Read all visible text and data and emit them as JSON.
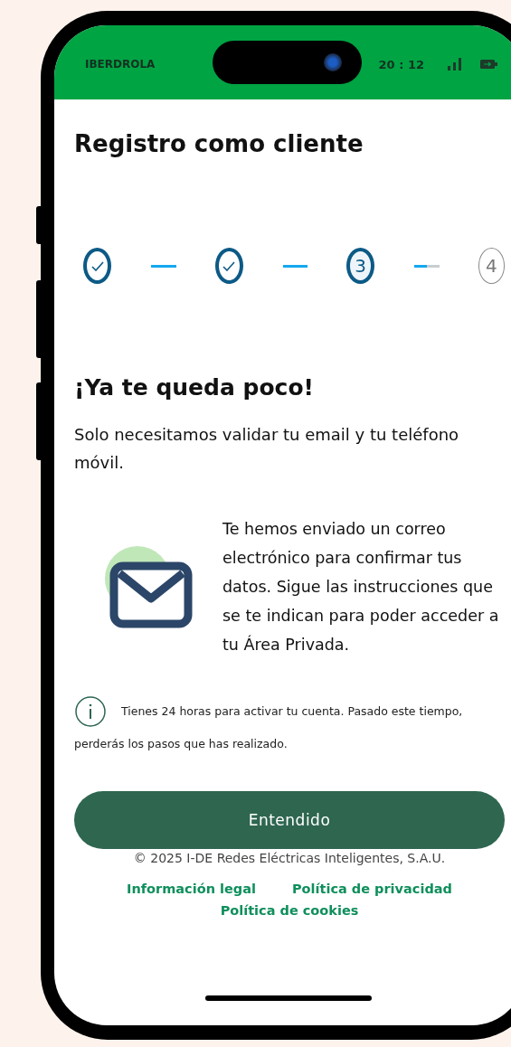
{
  "status_bar": {
    "carrier": "IBERDROLA",
    "time": "20 : 12"
  },
  "title": "Registro como cliente",
  "steps": [
    {
      "kind": "done"
    },
    {
      "kind": "done"
    },
    {
      "kind": "current",
      "label": "3"
    },
    {
      "kind": "pending",
      "label": "4"
    }
  ],
  "connectors": [
    {
      "level": 1
    },
    {
      "level": 1
    },
    {
      "level": 0.5
    }
  ],
  "heading": "¡Ya te queda poco!",
  "intro": "Solo necesitamos validar tu email y tu teléfono móvil.",
  "email_message": "Te hemos enviado un correo electrónico para confirmar tus datos. Sigue las instrucciones que se te indican para poder acceder a tu Área Privada.",
  "info_note": "Tienes 24 horas para activar tu cuenta. Pasado este tiempo, perderás los pasos que has realizado.",
  "button": "Entendido",
  "copyright": "© 2025 I-DE Redes Eléctricas Inteligentes, S.A.U.",
  "links": [
    "Información legal",
    "Política de privacidad",
    "Política de cookies"
  ]
}
